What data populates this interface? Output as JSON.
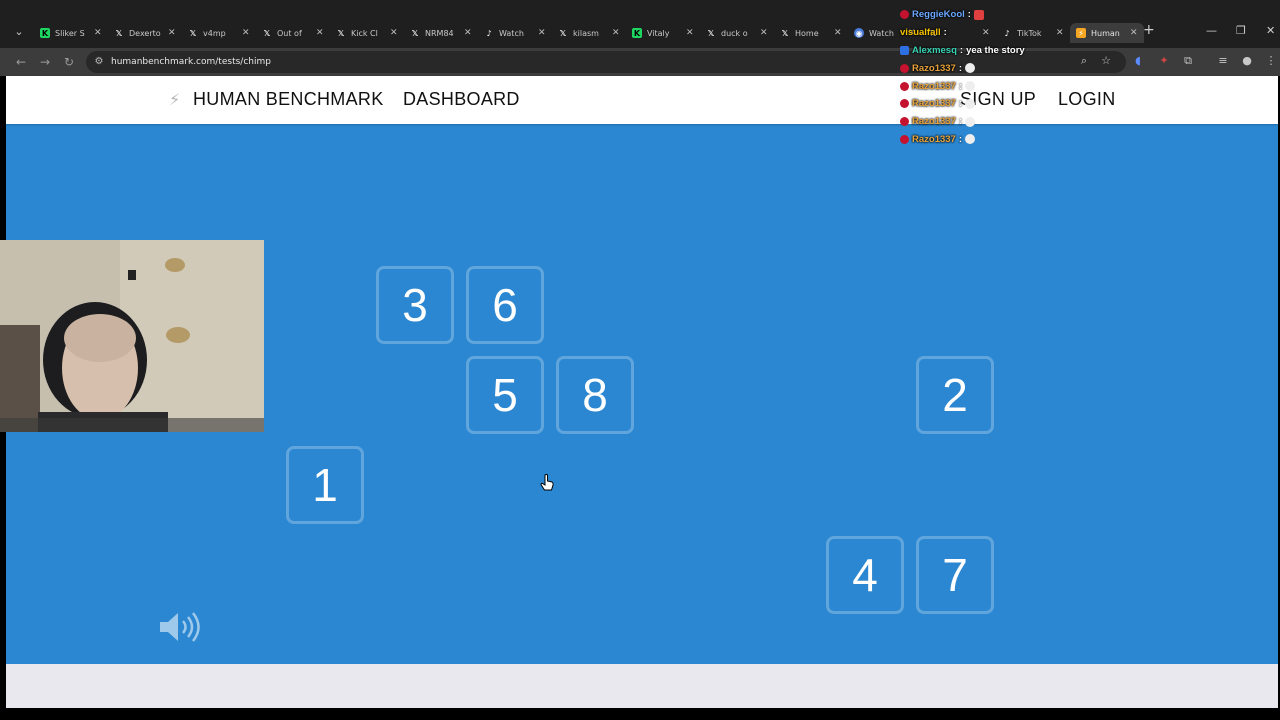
{
  "browser": {
    "tabs": [
      {
        "title": "Sliker S",
        "icon": "kick-icon",
        "kind": "kick"
      },
      {
        "title": "Dexerto",
        "icon": "x-icon",
        "kind": "x"
      },
      {
        "title": "v4mp",
        "icon": "x-icon",
        "kind": "x"
      },
      {
        "title": "Out of",
        "icon": "x-icon",
        "kind": "x"
      },
      {
        "title": "Kick Cl",
        "icon": "x-icon",
        "kind": "x"
      },
      {
        "title": "NRM84",
        "icon": "x-icon",
        "kind": "x"
      },
      {
        "title": "Watch",
        "icon": "tiktok-icon",
        "kind": "tiktok"
      },
      {
        "title": "kilasm",
        "icon": "x-icon",
        "kind": "x"
      },
      {
        "title": "Vitaly",
        "icon": "kick-icon",
        "kind": "kick"
      },
      {
        "title": "duck o",
        "icon": "x-icon",
        "kind": "x"
      },
      {
        "title": "Home",
        "icon": "x-icon",
        "kind": "x"
      },
      {
        "title": "Watch",
        "icon": "twitch-icon",
        "kind": "tw"
      },
      {
        "title": "",
        "icon": "tab-icon",
        "kind": "x"
      },
      {
        "title": "TikTok",
        "icon": "tiktok-icon",
        "kind": "tiktok"
      },
      {
        "title": "Human",
        "icon": "humanbenchmark-icon",
        "kind": "hb",
        "active": true
      }
    ],
    "url": "humanbenchmark.com/tests/chimp"
  },
  "navbar": {
    "brand": "HUMAN BENCHMARK",
    "dashboard": "DASHBOARD",
    "signup": "SIGN UP",
    "login": "LOGIN"
  },
  "tiles": [
    {
      "label": "3",
      "col": 1,
      "row": 0
    },
    {
      "label": "6",
      "col": 2,
      "row": 0
    },
    {
      "label": "5",
      "col": 2,
      "row": 1
    },
    {
      "label": "8",
      "col": 3,
      "row": 1
    },
    {
      "label": "2",
      "col": 7,
      "row": 1
    },
    {
      "label": "1",
      "col": 0,
      "row": 2
    },
    {
      "label": "4",
      "col": 6,
      "row": 3
    },
    {
      "label": "7",
      "col": 7,
      "row": 3
    }
  ],
  "chat": [
    {
      "user": "ReggieKool",
      "user_color": "#6aa6ff",
      "msg": "",
      "badge": "red",
      "emote": "red"
    },
    {
      "user": "visualfall",
      "user_color": "#f6c300",
      "msg": "",
      "badge": "none",
      "emote": ""
    },
    {
      "user": "Alexmesq",
      "user_color": "#39d3b4",
      "msg": "yea the story",
      "badge": "blue",
      "emote": ""
    },
    {
      "user": "Razo1337",
      "user_color": "#e8a23a",
      "msg": "",
      "badge": "red",
      "emote": "white"
    },
    {
      "user": "Razo1337",
      "user_color": "#e8a23a",
      "msg": "",
      "badge": "red",
      "emote": "white"
    },
    {
      "user": "Razo1337",
      "user_color": "#e8a23a",
      "msg": "",
      "badge": "red",
      "emote": "white"
    },
    {
      "user": "Razo1337",
      "user_color": "#e8a23a",
      "msg": "",
      "badge": "red",
      "emote": "white"
    },
    {
      "user": "Razo1337",
      "user_color": "#e8a23a",
      "msg": "",
      "badge": "red",
      "emote": "white"
    }
  ],
  "colors": {
    "page_bg": "#2b87d1",
    "navbar_bg": "#ffffff",
    "footer_bg": "#e8e8ee"
  }
}
